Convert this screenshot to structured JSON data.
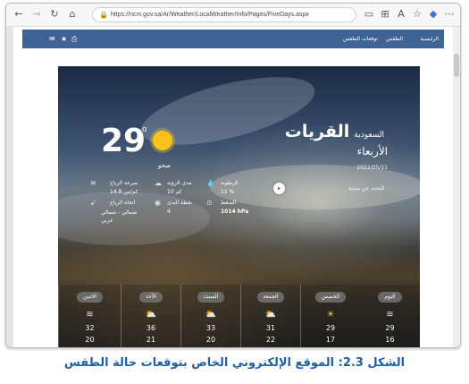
{
  "browser": {
    "url": "https://ncm.gov.sa/Ar/Weather/LocalWeather/Info/Pages/FiveDays.aspx"
  },
  "site_nav": {
    "items": [
      "الرئيسية",
      "الطقس",
      "توقعات الطقس"
    ]
  },
  "current": {
    "city": "القريات",
    "country": "السعودية",
    "day": "الأربعاء",
    "date": "2022/05/11",
    "search_link": "البحث عن مدينة",
    "temperature": "29",
    "degree_symbol": "o",
    "condition": "صحو",
    "wind_speed_label": "سرعة الرياح",
    "wind_speed_value": "14.8 كم/س",
    "wind_dir_label": "اتجاه الرياح",
    "wind_dir_value": "شمالي - شمالي غربي",
    "visibility_label": "مدى الرؤية",
    "visibility_value": "10 كم",
    "dew_label": "نقطة الندى",
    "dew_value": "4",
    "humidity_label": "الرطوبة",
    "humidity_value": "11 %",
    "pressure_label": "الضغط",
    "pressure_value": "1014 hPa"
  },
  "forecast": [
    {
      "day": "اليوم",
      "high": "29",
      "low": "16",
      "icon": "wind-icon"
    },
    {
      "day": "الخميس",
      "high": "29",
      "low": "17",
      "icon": "sun-icon"
    },
    {
      "day": "الجمعة",
      "high": "31",
      "low": "22",
      "icon": "partly-cloudy-icon"
    },
    {
      "day": "السبت",
      "high": "33",
      "low": "20",
      "icon": "partly-cloudy-icon"
    },
    {
      "day": "الأحد",
      "high": "36",
      "low": "21",
      "icon": "partly-cloudy-icon"
    },
    {
      "day": "الاثنين",
      "high": "32",
      "low": "20",
      "icon": "wind-icon"
    }
  ],
  "caption": "الشكل 2.3: الموقع الإلكتروني الخاص بتوقعات حالة الطقس"
}
